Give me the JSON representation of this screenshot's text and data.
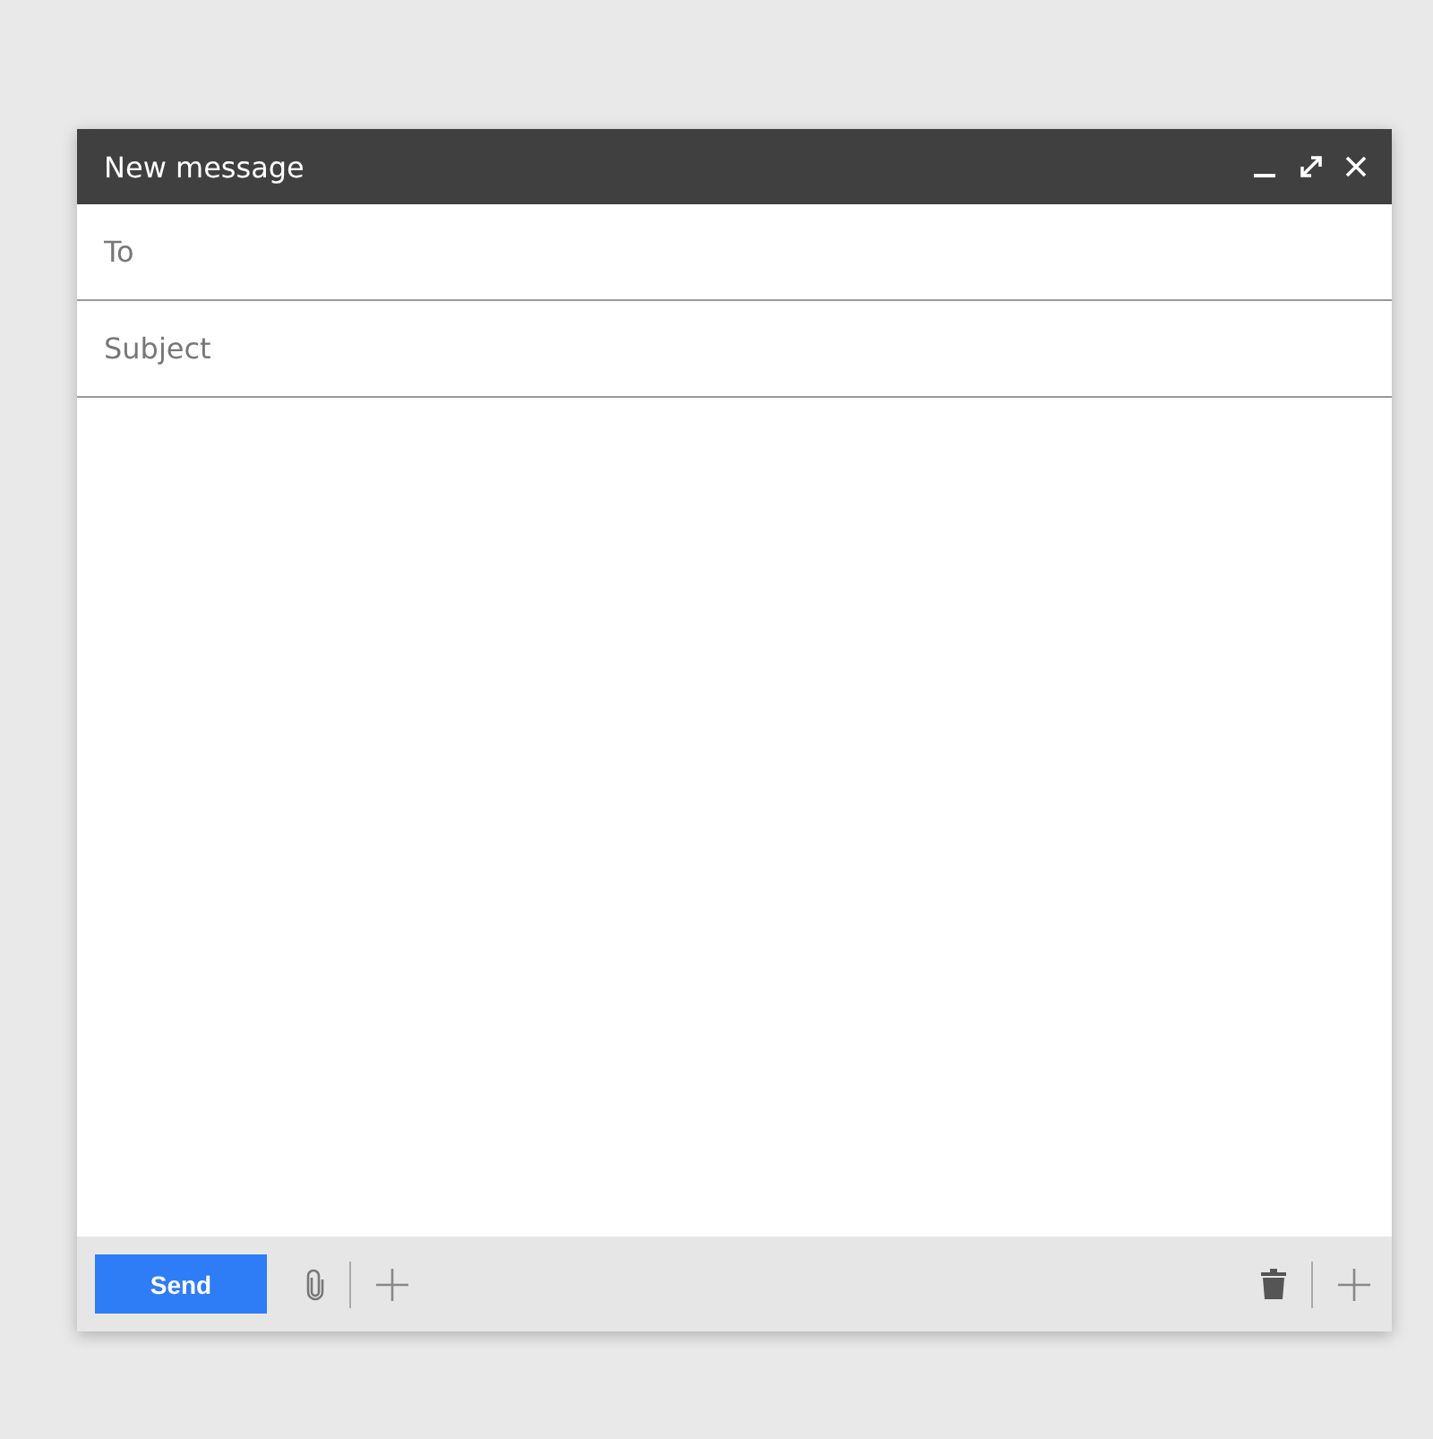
{
  "window": {
    "title": "New message"
  },
  "fields": [
    {
      "placeholder": "To"
    },
    {
      "placeholder": "Subject"
    }
  ],
  "footer": {
    "send_button": "Send"
  }
}
